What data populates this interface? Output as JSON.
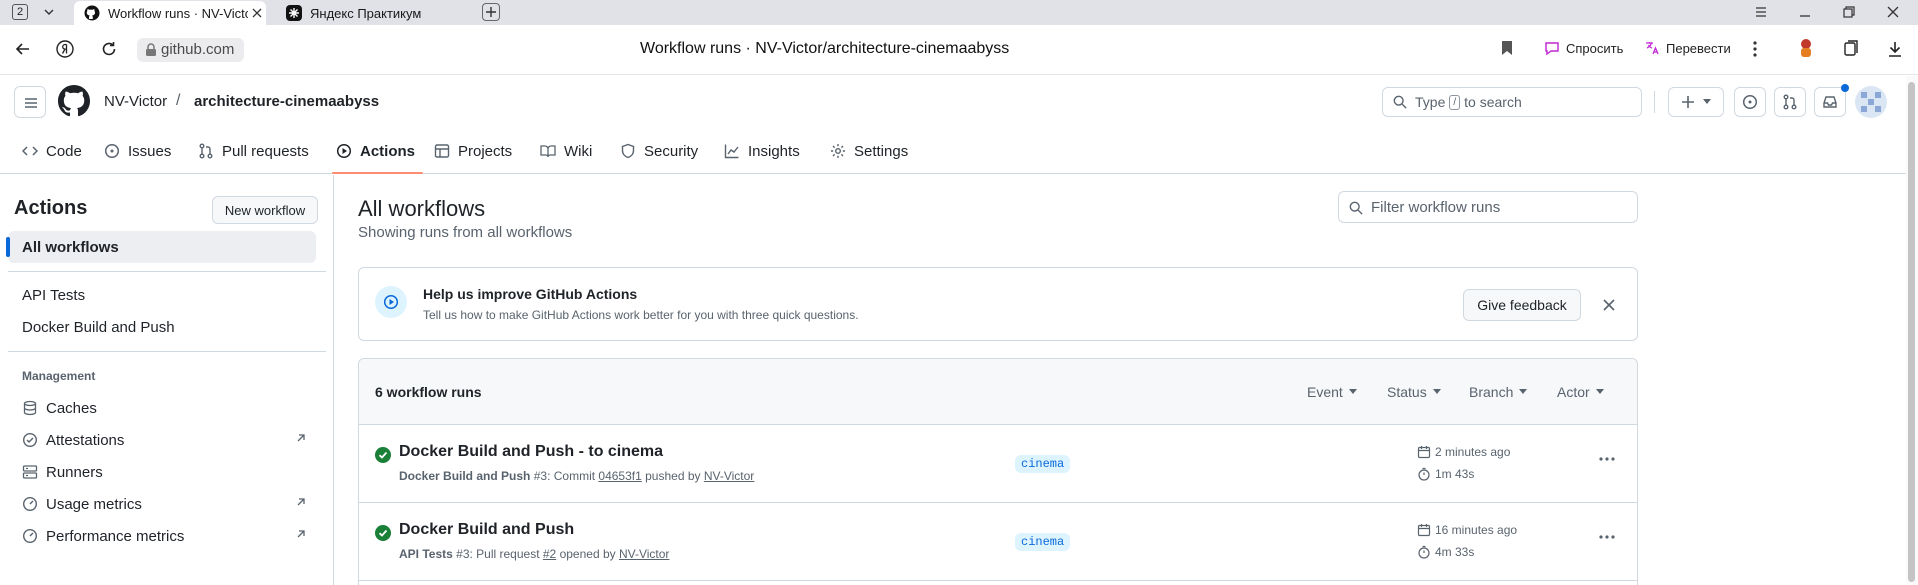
{
  "browser": {
    "tab_count": "2",
    "tabs": [
      {
        "title": "Workflow runs · NV-Victor"
      },
      {
        "title": "Яндекс Практикум"
      }
    ],
    "host": "github.com",
    "page_title": "Workflow runs · NV-Victor/architecture-cinemaabyss",
    "ask_label": "Спросить",
    "translate_label": "Перевести"
  },
  "header": {
    "owner": "NV-Victor",
    "separator": "/",
    "repo": "architecture-cinemaabyss",
    "search_prefix": "Type",
    "search_key": "/",
    "search_suffix": "to search"
  },
  "repo_nav": {
    "items": [
      {
        "label": "Code"
      },
      {
        "label": "Issues"
      },
      {
        "label": "Pull requests"
      },
      {
        "label": "Actions"
      },
      {
        "label": "Projects"
      },
      {
        "label": "Wiki"
      },
      {
        "label": "Security"
      },
      {
        "label": "Insights"
      },
      {
        "label": "Settings"
      }
    ]
  },
  "sidebar": {
    "title": "Actions",
    "new_workflow": "New workflow",
    "all_workflows": "All workflows",
    "workflows": [
      {
        "label": "API Tests"
      },
      {
        "label": "Docker Build and Push"
      }
    ],
    "management_heading": "Management",
    "management": [
      {
        "label": "Caches"
      },
      {
        "label": "Attestations"
      },
      {
        "label": "Runners"
      },
      {
        "label": "Usage metrics"
      },
      {
        "label": "Performance metrics"
      }
    ]
  },
  "main": {
    "title": "All workflows",
    "subtitle": "Showing runs from all workflows",
    "filter_placeholder": "Filter workflow runs",
    "banner": {
      "title": "Help us improve GitHub Actions",
      "description": "Tell us how to make GitHub Actions work better for you with three quick questions.",
      "feedback_button": "Give feedback"
    },
    "runs_count": "6 workflow runs",
    "filters": [
      "Event",
      "Status",
      "Branch",
      "Actor"
    ],
    "runs": [
      {
        "title": "Docker Build and Push - to cinema",
        "workflow": "Docker Build and Push",
        "run_number": "#3",
        "trigger_text": ": Commit ",
        "ref": "04653f1",
        "action_text": " pushed by ",
        "actor": "NV-Victor",
        "branch": "cinema",
        "time": "2 minutes ago",
        "duration": "1m 43s"
      },
      {
        "title": "Docker Build and Push",
        "workflow": "API Tests",
        "run_number": "#3",
        "trigger_text": ": Pull request ",
        "ref": "#2",
        "action_text": " opened by ",
        "actor": "NV-Victor",
        "branch": "cinema",
        "time": "16 minutes ago",
        "duration": "4m 33s"
      }
    ]
  }
}
